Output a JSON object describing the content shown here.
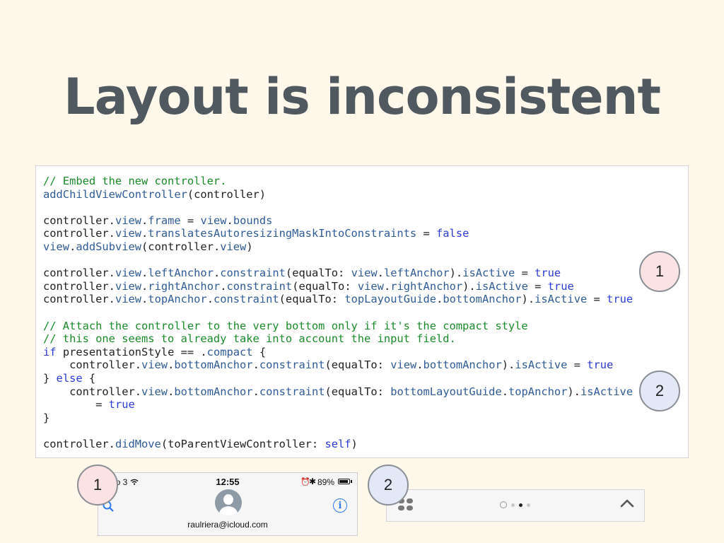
{
  "slide": {
    "title": "Layout is inconsistent"
  },
  "code_lines": [
    [
      {
        "t": "// Embed the new controller.",
        "c": "comment"
      }
    ],
    [
      {
        "t": "addChildViewController",
        "c": "ref"
      },
      {
        "t": "(controller)",
        "c": "plain"
      }
    ],
    [],
    [
      {
        "t": "controller.",
        "c": "plain"
      },
      {
        "t": "view",
        "c": "ref"
      },
      {
        "t": ".",
        "c": "plain"
      },
      {
        "t": "frame",
        "c": "ref"
      },
      {
        "t": " = ",
        "c": "plain"
      },
      {
        "t": "view",
        "c": "ref"
      },
      {
        "t": ".",
        "c": "plain"
      },
      {
        "t": "bounds",
        "c": "ref"
      }
    ],
    [
      {
        "t": "controller.",
        "c": "plain"
      },
      {
        "t": "view",
        "c": "ref"
      },
      {
        "t": ".",
        "c": "plain"
      },
      {
        "t": "translatesAutoresizingMaskIntoConstraints",
        "c": "ref"
      },
      {
        "t": " = ",
        "c": "plain"
      },
      {
        "t": "false",
        "c": "keyword"
      }
    ],
    [
      {
        "t": "view",
        "c": "ref"
      },
      {
        "t": ".",
        "c": "plain"
      },
      {
        "t": "addSubview",
        "c": "ref"
      },
      {
        "t": "(controller.",
        "c": "plain"
      },
      {
        "t": "view",
        "c": "ref"
      },
      {
        "t": ")",
        "c": "plain"
      }
    ],
    [],
    [
      {
        "t": "controller.",
        "c": "plain"
      },
      {
        "t": "view",
        "c": "ref"
      },
      {
        "t": ".",
        "c": "plain"
      },
      {
        "t": "leftAnchor",
        "c": "ref"
      },
      {
        "t": ".",
        "c": "plain"
      },
      {
        "t": "constraint",
        "c": "ref"
      },
      {
        "t": "(equalTo: ",
        "c": "plain"
      },
      {
        "t": "view",
        "c": "ref"
      },
      {
        "t": ".",
        "c": "plain"
      },
      {
        "t": "leftAnchor",
        "c": "ref"
      },
      {
        "t": ").",
        "c": "plain"
      },
      {
        "t": "isActive",
        "c": "ref"
      },
      {
        "t": " = ",
        "c": "plain"
      },
      {
        "t": "true",
        "c": "keyword"
      }
    ],
    [
      {
        "t": "controller.",
        "c": "plain"
      },
      {
        "t": "view",
        "c": "ref"
      },
      {
        "t": ".",
        "c": "plain"
      },
      {
        "t": "rightAnchor",
        "c": "ref"
      },
      {
        "t": ".",
        "c": "plain"
      },
      {
        "t": "constraint",
        "c": "ref"
      },
      {
        "t": "(equalTo: ",
        "c": "plain"
      },
      {
        "t": "view",
        "c": "ref"
      },
      {
        "t": ".",
        "c": "plain"
      },
      {
        "t": "rightAnchor",
        "c": "ref"
      },
      {
        "t": ").",
        "c": "plain"
      },
      {
        "t": "isActive",
        "c": "ref"
      },
      {
        "t": " = ",
        "c": "plain"
      },
      {
        "t": "true",
        "c": "keyword"
      }
    ],
    [
      {
        "t": "controller.",
        "c": "plain"
      },
      {
        "t": "view",
        "c": "ref"
      },
      {
        "t": ".",
        "c": "plain"
      },
      {
        "t": "topAnchor",
        "c": "ref"
      },
      {
        "t": ".",
        "c": "plain"
      },
      {
        "t": "constraint",
        "c": "ref"
      },
      {
        "t": "(equalTo: ",
        "c": "plain"
      },
      {
        "t": "topLayoutGuide",
        "c": "ref"
      },
      {
        "t": ".",
        "c": "plain"
      },
      {
        "t": "bottomAnchor",
        "c": "ref"
      },
      {
        "t": ").",
        "c": "plain"
      },
      {
        "t": "isActive",
        "c": "ref"
      },
      {
        "t": " = ",
        "c": "plain"
      },
      {
        "t": "true",
        "c": "keyword"
      }
    ],
    [],
    [
      {
        "t": "// Attach the controller to the very bottom only if it's the compact style",
        "c": "comment"
      }
    ],
    [
      {
        "t": "// this one seems to already take into account the input field.",
        "c": "comment"
      }
    ],
    [
      {
        "t": "if",
        "c": "keyword"
      },
      {
        "t": " presentationStyle == .",
        "c": "plain"
      },
      {
        "t": "compact",
        "c": "ref"
      },
      {
        "t": " {",
        "c": "plain"
      }
    ],
    [
      {
        "t": "    controller.",
        "c": "plain"
      },
      {
        "t": "view",
        "c": "ref"
      },
      {
        "t": ".",
        "c": "plain"
      },
      {
        "t": "bottomAnchor",
        "c": "ref"
      },
      {
        "t": ".",
        "c": "plain"
      },
      {
        "t": "constraint",
        "c": "ref"
      },
      {
        "t": "(equalTo: ",
        "c": "plain"
      },
      {
        "t": "view",
        "c": "ref"
      },
      {
        "t": ".",
        "c": "plain"
      },
      {
        "t": "bottomAnchor",
        "c": "ref"
      },
      {
        "t": ").",
        "c": "plain"
      },
      {
        "t": "isActive",
        "c": "ref"
      },
      {
        "t": " = ",
        "c": "plain"
      },
      {
        "t": "true",
        "c": "keyword"
      }
    ],
    [
      {
        "t": "} ",
        "c": "plain"
      },
      {
        "t": "else",
        "c": "keyword"
      },
      {
        "t": " {",
        "c": "plain"
      }
    ],
    [
      {
        "t": "    controller.",
        "c": "plain"
      },
      {
        "t": "view",
        "c": "ref"
      },
      {
        "t": ".",
        "c": "plain"
      },
      {
        "t": "bottomAnchor",
        "c": "ref"
      },
      {
        "t": ".",
        "c": "plain"
      },
      {
        "t": "constraint",
        "c": "ref"
      },
      {
        "t": "(equalTo: ",
        "c": "plain"
      },
      {
        "t": "bottomLayoutGuide",
        "c": "ref"
      },
      {
        "t": ".",
        "c": "plain"
      },
      {
        "t": "topAnchor",
        "c": "ref"
      },
      {
        "t": ").",
        "c": "plain"
      },
      {
        "t": "isActive",
        "c": "ref"
      }
    ],
    [
      {
        "t": "        = ",
        "c": "plain"
      },
      {
        "t": "true",
        "c": "keyword"
      }
    ],
    [
      {
        "t": "}",
        "c": "plain"
      }
    ],
    [],
    [
      {
        "t": "controller.",
        "c": "plain"
      },
      {
        "t": "didMove",
        "c": "ref"
      },
      {
        "t": "(toParentViewController: ",
        "c": "plain"
      },
      {
        "t": "self",
        "c": "keyword"
      },
      {
        "t": ")",
        "c": "plain"
      }
    ]
  ],
  "markers": {
    "code_1": "1",
    "code_2": "2",
    "bottom_1": "1",
    "bottom_2": "2"
  },
  "phone": {
    "carrier": "ɒo 3",
    "time": "12:55",
    "battery": "89%",
    "battery_level": 0.89,
    "email": "raulriera@icloud.com",
    "info_glyph": "i"
  },
  "colors": {
    "background": "#fdf8ea",
    "title": "#505860",
    "comment": "#1b8a2a",
    "keyword": "#2a3bd6",
    "reference": "#2f5b97",
    "ios_blue": "#2f7cf6"
  },
  "icons": [
    "search-icon",
    "info-icon",
    "wifi-icon",
    "alarm-icon",
    "bluetooth-icon",
    "battery-icon",
    "apps-icon",
    "clock-icon",
    "chevron-up-icon",
    "avatar-icon"
  ]
}
